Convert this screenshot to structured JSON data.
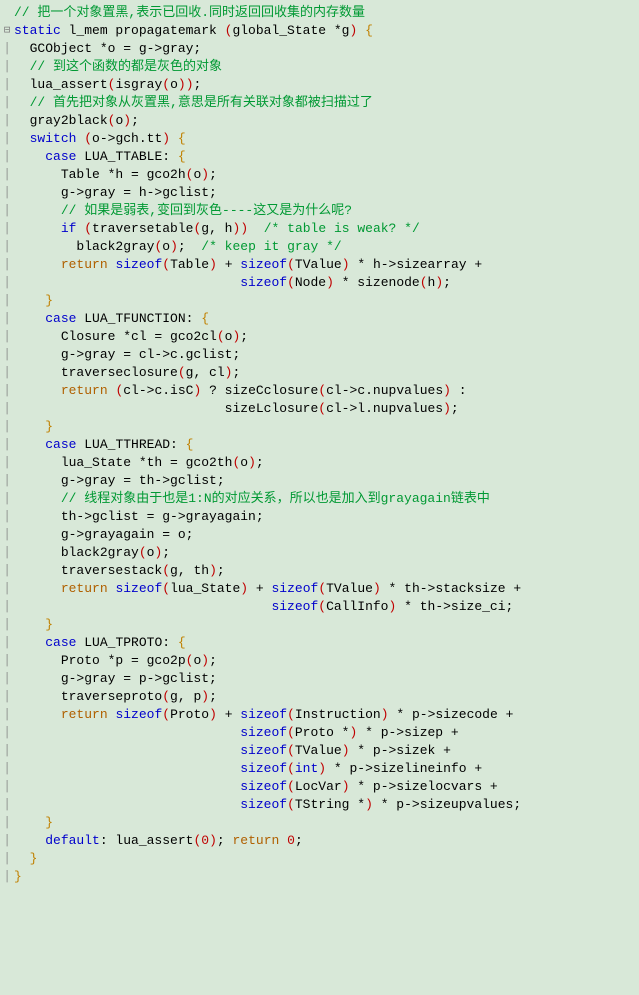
{
  "gutter": {
    "fold_minus": "⊟",
    "fold_bar": "│"
  },
  "code": {
    "lines": [
      {
        "i": "",
        "c": "// 把一个对象置黑,表示已回收.同时返回回收集的内存数量",
        "cls": "c-comment"
      },
      {
        "i": "",
        "seg": [
          {
            "t": "static",
            "cls": "c-keyword"
          },
          {
            "t": " l_mem propagatemark "
          },
          {
            "t": "(",
            "cls": "c-paren"
          },
          {
            "t": "global_State *g"
          },
          {
            "t": ")",
            "cls": "c-paren"
          },
          {
            "t": " "
          },
          {
            "t": "{",
            "cls": "c-brace"
          }
        ]
      },
      {
        "i": "  ",
        "seg": [
          {
            "t": "GCObject *o = g->gray;"
          }
        ]
      },
      {
        "i": "  ",
        "c": "// 到这个函数的都是灰色的对象",
        "cls": "c-comment"
      },
      {
        "i": "  ",
        "seg": [
          {
            "t": "lua_assert"
          },
          {
            "t": "(",
            "cls": "c-paren"
          },
          {
            "t": "isgray"
          },
          {
            "t": "(",
            "cls": "c-paren"
          },
          {
            "t": "o"
          },
          {
            "t": ")",
            "cls": "c-paren"
          },
          {
            "t": ")",
            "cls": "c-paren"
          },
          {
            "t": ";"
          }
        ]
      },
      {
        "i": "  ",
        "c": "// 首先把对象从灰置黑,意思是所有关联对象都被扫描过了",
        "cls": "c-comment"
      },
      {
        "i": "  ",
        "seg": [
          {
            "t": "gray2black"
          },
          {
            "t": "(",
            "cls": "c-paren"
          },
          {
            "t": "o"
          },
          {
            "t": ")",
            "cls": "c-paren"
          },
          {
            "t": ";"
          }
        ]
      },
      {
        "i": "  ",
        "seg": [
          {
            "t": "switch",
            "cls": "c-keyword"
          },
          {
            "t": " "
          },
          {
            "t": "(",
            "cls": "c-paren"
          },
          {
            "t": "o->gch.tt"
          },
          {
            "t": ")",
            "cls": "c-paren"
          },
          {
            "t": " "
          },
          {
            "t": "{",
            "cls": "c-brace"
          }
        ]
      },
      {
        "i": "    ",
        "seg": [
          {
            "t": "case",
            "cls": "c-keyword"
          },
          {
            "t": " LUA_TTABLE: "
          },
          {
            "t": "{",
            "cls": "c-brace"
          }
        ]
      },
      {
        "i": "      ",
        "seg": [
          {
            "t": "Table *h = gco2h"
          },
          {
            "t": "(",
            "cls": "c-paren"
          },
          {
            "t": "o"
          },
          {
            "t": ")",
            "cls": "c-paren"
          },
          {
            "t": ";"
          }
        ]
      },
      {
        "i": "      ",
        "seg": [
          {
            "t": "g->gray = h->gclist;"
          }
        ]
      },
      {
        "i": "      ",
        "c": "// 如果是弱表,变回到灰色----这又是为什么呢?",
        "cls": "c-comment"
      },
      {
        "i": "      ",
        "seg": [
          {
            "t": "if",
            "cls": "c-keyword"
          },
          {
            "t": " "
          },
          {
            "t": "(",
            "cls": "c-paren"
          },
          {
            "t": "traversetable"
          },
          {
            "t": "(",
            "cls": "c-paren"
          },
          {
            "t": "g, h"
          },
          {
            "t": ")",
            "cls": "c-paren"
          },
          {
            "t": ")",
            "cls": "c-paren"
          },
          {
            "t": "  "
          },
          {
            "t": "/* table is weak? */",
            "cls": "c-comment"
          }
        ]
      },
      {
        "i": "        ",
        "seg": [
          {
            "t": "black2gray"
          },
          {
            "t": "(",
            "cls": "c-paren"
          },
          {
            "t": "o"
          },
          {
            "t": ")",
            "cls": "c-paren"
          },
          {
            "t": ";  "
          },
          {
            "t": "/* keep it gray */",
            "cls": "c-comment"
          }
        ]
      },
      {
        "i": "      ",
        "seg": [
          {
            "t": "return",
            "cls": "c-return"
          },
          {
            "t": " "
          },
          {
            "t": "sizeof",
            "cls": "c-keyword"
          },
          {
            "t": "(",
            "cls": "c-paren"
          },
          {
            "t": "Table"
          },
          {
            "t": ")",
            "cls": "c-paren"
          },
          {
            "t": " + "
          },
          {
            "t": "sizeof",
            "cls": "c-keyword"
          },
          {
            "t": "(",
            "cls": "c-paren"
          },
          {
            "t": "TValue"
          },
          {
            "t": ")",
            "cls": "c-paren"
          },
          {
            "t": " * h->sizearray +"
          }
        ]
      },
      {
        "i": "                             ",
        "seg": [
          {
            "t": "sizeof",
            "cls": "c-keyword"
          },
          {
            "t": "(",
            "cls": "c-paren"
          },
          {
            "t": "Node"
          },
          {
            "t": ")",
            "cls": "c-paren"
          },
          {
            "t": " * sizenode"
          },
          {
            "t": "(",
            "cls": "c-paren"
          },
          {
            "t": "h"
          },
          {
            "t": ")",
            "cls": "c-paren"
          },
          {
            "t": ";"
          }
        ]
      },
      {
        "i": "    ",
        "seg": [
          {
            "t": "}",
            "cls": "c-brace"
          }
        ]
      },
      {
        "i": "    ",
        "seg": [
          {
            "t": "case",
            "cls": "c-keyword"
          },
          {
            "t": " LUA_TFUNCTION: "
          },
          {
            "t": "{",
            "cls": "c-brace"
          }
        ]
      },
      {
        "i": "      ",
        "seg": [
          {
            "t": "Closure *cl = gco2cl"
          },
          {
            "t": "(",
            "cls": "c-paren"
          },
          {
            "t": "o"
          },
          {
            "t": ")",
            "cls": "c-paren"
          },
          {
            "t": ";"
          }
        ]
      },
      {
        "i": "      ",
        "seg": [
          {
            "t": "g->gray = cl->c.gclist;"
          }
        ]
      },
      {
        "i": "      ",
        "seg": [
          {
            "t": "traverseclosure"
          },
          {
            "t": "(",
            "cls": "c-paren"
          },
          {
            "t": "g, cl"
          },
          {
            "t": ")",
            "cls": "c-paren"
          },
          {
            "t": ";"
          }
        ]
      },
      {
        "i": "      ",
        "seg": [
          {
            "t": "return",
            "cls": "c-return"
          },
          {
            "t": " "
          },
          {
            "t": "(",
            "cls": "c-paren"
          },
          {
            "t": "cl->c.isC"
          },
          {
            "t": ")",
            "cls": "c-paren"
          },
          {
            "t": " ? sizeCclosure"
          },
          {
            "t": "(",
            "cls": "c-paren"
          },
          {
            "t": "cl->c.nupvalues"
          },
          {
            "t": ")",
            "cls": "c-paren"
          },
          {
            "t": " :"
          }
        ]
      },
      {
        "i": "                           ",
        "seg": [
          {
            "t": "sizeLclosure"
          },
          {
            "t": "(",
            "cls": "c-paren"
          },
          {
            "t": "cl->l.nupvalues"
          },
          {
            "t": ")",
            "cls": "c-paren"
          },
          {
            "t": ";"
          }
        ]
      },
      {
        "i": "    ",
        "seg": [
          {
            "t": "}",
            "cls": "c-brace"
          }
        ]
      },
      {
        "i": "    ",
        "seg": [
          {
            "t": "case",
            "cls": "c-keyword"
          },
          {
            "t": " LUA_TTHREAD: "
          },
          {
            "t": "{",
            "cls": "c-brace"
          }
        ]
      },
      {
        "i": "      ",
        "seg": [
          {
            "t": "lua_State *th = gco2th"
          },
          {
            "t": "(",
            "cls": "c-paren"
          },
          {
            "t": "o"
          },
          {
            "t": ")",
            "cls": "c-paren"
          },
          {
            "t": ";"
          }
        ]
      },
      {
        "i": "      ",
        "seg": [
          {
            "t": "g->gray = th->gclist;"
          }
        ]
      },
      {
        "i": "      ",
        "c": "// 线程对象由于也是1:N的对应关系，所以也是加入到grayagain链表中",
        "cls": "c-comment"
      },
      {
        "i": "      ",
        "seg": [
          {
            "t": "th->gclist = g->grayagain;"
          }
        ]
      },
      {
        "i": "      ",
        "seg": [
          {
            "t": "g->grayagain = o;"
          }
        ]
      },
      {
        "i": "      ",
        "seg": [
          {
            "t": "black2gray"
          },
          {
            "t": "(",
            "cls": "c-paren"
          },
          {
            "t": "o"
          },
          {
            "t": ")",
            "cls": "c-paren"
          },
          {
            "t": ";"
          }
        ]
      },
      {
        "i": "      ",
        "seg": [
          {
            "t": "traversestack"
          },
          {
            "t": "(",
            "cls": "c-paren"
          },
          {
            "t": "g, th"
          },
          {
            "t": ")",
            "cls": "c-paren"
          },
          {
            "t": ";"
          }
        ]
      },
      {
        "i": "      ",
        "seg": [
          {
            "t": "return",
            "cls": "c-return"
          },
          {
            "t": " "
          },
          {
            "t": "sizeof",
            "cls": "c-keyword"
          },
          {
            "t": "(",
            "cls": "c-paren"
          },
          {
            "t": "lua_State"
          },
          {
            "t": ")",
            "cls": "c-paren"
          },
          {
            "t": " + "
          },
          {
            "t": "sizeof",
            "cls": "c-keyword"
          },
          {
            "t": "(",
            "cls": "c-paren"
          },
          {
            "t": "TValue"
          },
          {
            "t": ")",
            "cls": "c-paren"
          },
          {
            "t": " * th->stacksize +"
          }
        ]
      },
      {
        "i": "                                 ",
        "seg": [
          {
            "t": "sizeof",
            "cls": "c-keyword"
          },
          {
            "t": "(",
            "cls": "c-paren"
          },
          {
            "t": "CallInfo"
          },
          {
            "t": ")",
            "cls": "c-paren"
          },
          {
            "t": " * th->size_ci;"
          }
        ]
      },
      {
        "i": "    ",
        "seg": [
          {
            "t": "}",
            "cls": "c-brace"
          }
        ]
      },
      {
        "i": "    ",
        "seg": [
          {
            "t": "case",
            "cls": "c-keyword"
          },
          {
            "t": " LUA_TPROTO: "
          },
          {
            "t": "{",
            "cls": "c-brace"
          }
        ]
      },
      {
        "i": "      ",
        "seg": [
          {
            "t": "Proto *p = gco2p"
          },
          {
            "t": "(",
            "cls": "c-paren"
          },
          {
            "t": "o"
          },
          {
            "t": ")",
            "cls": "c-paren"
          },
          {
            "t": ";"
          }
        ]
      },
      {
        "i": "      ",
        "seg": [
          {
            "t": "g->gray = p->gclist;"
          }
        ]
      },
      {
        "i": "      ",
        "seg": [
          {
            "t": "traverseproto"
          },
          {
            "t": "(",
            "cls": "c-paren"
          },
          {
            "t": "g, p"
          },
          {
            "t": ")",
            "cls": "c-paren"
          },
          {
            "t": ";"
          }
        ]
      },
      {
        "i": "      ",
        "seg": [
          {
            "t": "return",
            "cls": "c-return"
          },
          {
            "t": " "
          },
          {
            "t": "sizeof",
            "cls": "c-keyword"
          },
          {
            "t": "(",
            "cls": "c-paren"
          },
          {
            "t": "Proto"
          },
          {
            "t": ")",
            "cls": "c-paren"
          },
          {
            "t": " + "
          },
          {
            "t": "sizeof",
            "cls": "c-keyword"
          },
          {
            "t": "(",
            "cls": "c-paren"
          },
          {
            "t": "Instruction"
          },
          {
            "t": ")",
            "cls": "c-paren"
          },
          {
            "t": " * p->sizecode +"
          }
        ]
      },
      {
        "i": "                             ",
        "seg": [
          {
            "t": "sizeof",
            "cls": "c-keyword"
          },
          {
            "t": "(",
            "cls": "c-paren"
          },
          {
            "t": "Proto *"
          },
          {
            "t": ")",
            "cls": "c-paren"
          },
          {
            "t": " * p->sizep +"
          }
        ]
      },
      {
        "i": "                             ",
        "seg": [
          {
            "t": "sizeof",
            "cls": "c-keyword"
          },
          {
            "t": "(",
            "cls": "c-paren"
          },
          {
            "t": "TValue"
          },
          {
            "t": ")",
            "cls": "c-paren"
          },
          {
            "t": " * p->sizek +"
          }
        ]
      },
      {
        "i": "                             ",
        "seg": [
          {
            "t": "sizeof",
            "cls": "c-keyword"
          },
          {
            "t": "(",
            "cls": "c-paren"
          },
          {
            "t": "int",
            "cls": "c-keyword"
          },
          {
            "t": ")",
            "cls": "c-paren"
          },
          {
            "t": " * p->sizelineinfo +"
          }
        ]
      },
      {
        "i": "                             ",
        "seg": [
          {
            "t": "sizeof",
            "cls": "c-keyword"
          },
          {
            "t": "(",
            "cls": "c-paren"
          },
          {
            "t": "LocVar"
          },
          {
            "t": ")",
            "cls": "c-paren"
          },
          {
            "t": " * p->sizelocvars +"
          }
        ]
      },
      {
        "i": "                             ",
        "seg": [
          {
            "t": "sizeof",
            "cls": "c-keyword"
          },
          {
            "t": "(",
            "cls": "c-paren"
          },
          {
            "t": "TString *"
          },
          {
            "t": ")",
            "cls": "c-paren"
          },
          {
            "t": " * p->sizeupvalues;"
          }
        ]
      },
      {
        "i": "    ",
        "seg": [
          {
            "t": "}",
            "cls": "c-brace"
          }
        ]
      },
      {
        "i": "    ",
        "seg": [
          {
            "t": "default",
            "cls": "c-keyword"
          },
          {
            "t": ": lua_assert"
          },
          {
            "t": "(",
            "cls": "c-paren"
          },
          {
            "t": "0",
            "cls": "c-num"
          },
          {
            "t": ")",
            "cls": "c-paren"
          },
          {
            "t": "; "
          },
          {
            "t": "return",
            "cls": "c-return"
          },
          {
            "t": " "
          },
          {
            "t": "0",
            "cls": "c-num"
          },
          {
            "t": ";"
          }
        ]
      },
      {
        "i": "  ",
        "seg": [
          {
            "t": "}",
            "cls": "c-brace"
          }
        ]
      },
      {
        "i": "",
        "seg": [
          {
            "t": "}",
            "cls": "c-brace"
          }
        ]
      }
    ]
  }
}
